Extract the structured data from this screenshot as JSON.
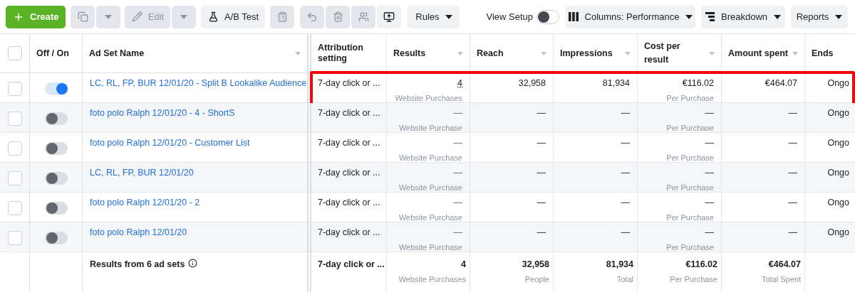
{
  "toolbar": {
    "create": {
      "label": "Create"
    },
    "duplicate": {
      "disabled": true
    },
    "edit": {
      "label": "Edit",
      "disabled": true
    },
    "ab_test": {
      "label": "A/B Test"
    },
    "clipboard": {
      "disabled": true
    },
    "undo": {
      "disabled": true
    },
    "delete": {
      "disabled": true
    },
    "audience": {
      "disabled": true
    },
    "export": {
      "disabled": false
    },
    "rules": {
      "label": "Rules"
    },
    "view_setup": {
      "label": "View Setup",
      "on": false
    },
    "columns": {
      "label": "Columns: Performance"
    },
    "breakdown": {
      "label": "Breakdown"
    },
    "reports": {
      "label": "Reports"
    }
  },
  "table": {
    "select_all": {
      "checked": false
    },
    "columns": [
      {
        "label": "Off / On",
        "sortable": false
      },
      {
        "label": "Ad Set Name",
        "sortable": true
      },
      {
        "label": "Attribution setting",
        "sortable": false
      },
      {
        "label": "Results",
        "sortable": true
      },
      {
        "label": "Reach",
        "sortable": true
      },
      {
        "label": "Impressions",
        "sortable": true
      },
      {
        "label": "Cost per result",
        "sortable": true
      },
      {
        "label": "Amount spent",
        "sortable": true
      },
      {
        "label": "Ends",
        "sortable": false
      }
    ],
    "rows": [
      {
        "checked": false,
        "on": true,
        "highlighted": true,
        "name": "LC, RL, FP, BUR 12/01/20 - Split B Lookalike Audience",
        "attribution": "7-day click or ...",
        "results": {
          "value": "4",
          "sub": "Website Purchases"
        },
        "reach": "32,958",
        "impressions": "81,934",
        "cost": {
          "value": "€116.02",
          "sub": "Per Purchase"
        },
        "amount": "€464.07",
        "ends": "Ongo"
      },
      {
        "checked": false,
        "on": false,
        "highlighted": false,
        "name": "foto polo Ralph 12/01/20 - 4 - ShortS",
        "attribution": "7-day click or ...",
        "results": {
          "value": "—",
          "sub": "Website Purchase"
        },
        "reach": "—",
        "impressions": "—",
        "cost": {
          "value": "—",
          "sub": "Per Purchase"
        },
        "amount": "—",
        "ends": "Ongo"
      },
      {
        "checked": false,
        "on": false,
        "highlighted": false,
        "name": "foto polo Ralph 12/01/20 - Customer List",
        "attribution": "7-day click or ...",
        "results": {
          "value": "—",
          "sub": "Website Purchase"
        },
        "reach": "—",
        "impressions": "—",
        "cost": {
          "value": "—",
          "sub": "Per Purchase"
        },
        "amount": "—",
        "ends": "Ongo"
      },
      {
        "checked": false,
        "on": false,
        "highlighted": false,
        "name": "LC, RL, FP, BUR 12/01/20",
        "attribution": "7-day click or ...",
        "results": {
          "value": "—",
          "sub": "Website Purchase"
        },
        "reach": "—",
        "impressions": "—",
        "cost": {
          "value": "—",
          "sub": "Per Purchase"
        },
        "amount": "—",
        "ends": "Ongo"
      },
      {
        "checked": false,
        "on": false,
        "highlighted": false,
        "name": "foto polo Ralph 12/01/20 - 2",
        "attribution": "7-day click or ...",
        "results": {
          "value": "—",
          "sub": "Website Purchase"
        },
        "reach": "—",
        "impressions": "—",
        "cost": {
          "value": "—",
          "sub": "Per Purchase"
        },
        "amount": "—",
        "ends": "Ongo"
      },
      {
        "checked": false,
        "on": false,
        "highlighted": false,
        "name": "foto polo Ralph 12/01/20",
        "attribution": "7-day click or ...",
        "results": {
          "value": "—",
          "sub": "Website Purchase"
        },
        "reach": "—",
        "impressions": "—",
        "cost": {
          "value": "—",
          "sub": "Per Purchase"
        },
        "amount": "—",
        "ends": "Ongo"
      }
    ],
    "footer": {
      "label": "Results from 6 ad sets",
      "attribution": "7-day click or ...",
      "results": {
        "value": "4",
        "sub": "Website Purchases"
      },
      "reach": {
        "value": "32,958",
        "sub": "People"
      },
      "impressions": {
        "value": "81,934",
        "sub": "Total"
      },
      "cost": {
        "value": "€116.02",
        "sub": "Per Purchase"
      },
      "amount": {
        "value": "€464.07",
        "sub": "Total Spent"
      }
    }
  }
}
